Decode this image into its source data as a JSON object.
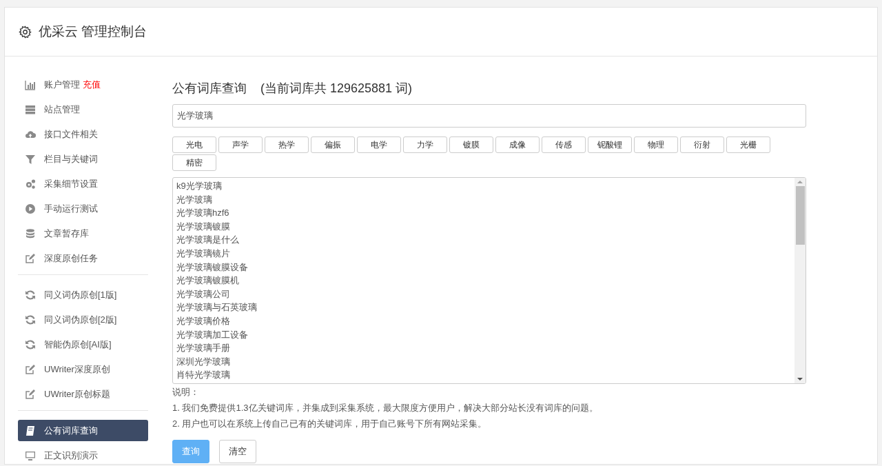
{
  "header": {
    "title": "优采云 管理控制台"
  },
  "sidebar": {
    "groups": [
      [
        {
          "label": "账户管理",
          "link": "充值",
          "selected": false
        },
        {
          "label": "站点管理",
          "selected": false
        },
        {
          "label": "接口文件相关",
          "selected": false
        },
        {
          "label": "栏目与关键词",
          "selected": false
        },
        {
          "label": "采集细节设置",
          "selected": false
        },
        {
          "label": "手动运行测试",
          "selected": false
        },
        {
          "label": "文章暂存库",
          "selected": false
        },
        {
          "label": "深度原创任务",
          "selected": false
        }
      ],
      [
        {
          "label": "同义词伪原创[1版]",
          "selected": false
        },
        {
          "label": "同义词伪原创[2版]",
          "selected": false
        },
        {
          "label": "智能伪原创[AI版]",
          "selected": false
        },
        {
          "label": "UWriter深度原创",
          "selected": false
        },
        {
          "label": "UWriter原创标题",
          "selected": false
        }
      ],
      [
        {
          "label": "公有词库查询",
          "selected": true
        },
        {
          "label": "正文识别演示",
          "selected": false
        }
      ]
    ]
  },
  "main": {
    "title": "公有词库查询",
    "count_note": "(当前词库共 129625881 词)",
    "search": {
      "value": "光学玻璃"
    },
    "tags": [
      "光电",
      "声学",
      "热学",
      "偏振",
      "电学",
      "力学",
      "镀膜",
      "成像",
      "传感",
      "铌酸锂",
      "物理",
      "衍射",
      "光栅",
      "精密"
    ],
    "results": [
      "k9光学玻璃",
      "光学玻璃",
      "光学玻璃hzf6",
      "光学玻璃镀膜",
      "光学玻璃是什么",
      "光学玻璃镜片",
      "光学玻璃镀膜设备",
      "光学玻璃镀膜机",
      "光学玻璃公司",
      "光学玻璃与石英玻璃",
      "光学玻璃价格",
      "光学玻璃加工设备",
      "光学玻璃手册",
      "深圳光学玻璃",
      "肖特光学玻璃"
    ],
    "notes_title": "说明：",
    "notes": [
      "1. 我们免费提供1.3亿关键词库，并集成到采集系统，最大限度方便用户，解决大部分站长没有词库的问题。",
      "2. 用户也可以在系统上传自己已有的关键词库，用于自己账号下所有网站采集。"
    ],
    "buttons": [
      {
        "label": "查询",
        "kind": "primary"
      },
      {
        "label": "清空",
        "kind": "default"
      }
    ]
  }
}
